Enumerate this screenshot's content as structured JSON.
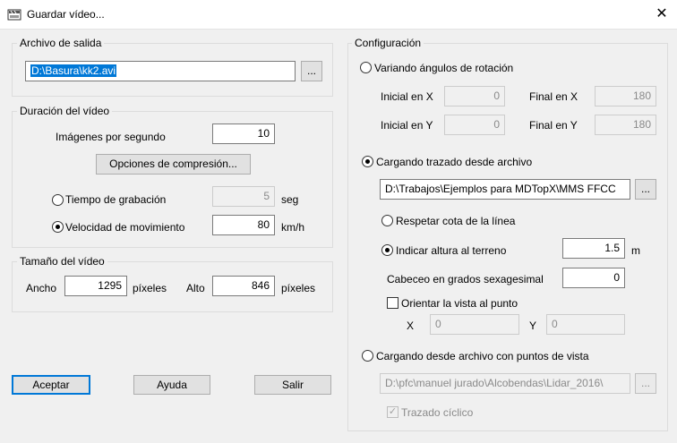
{
  "window": {
    "title": "Guardar vídeo...",
    "close_glyph": "✕"
  },
  "salida": {
    "legend": "Archivo de salida",
    "path": "D:\\Basura\\kk2.avi",
    "browse": "..."
  },
  "duracion": {
    "legend": "Duración del vídeo",
    "fps_label": "Imágenes por segundo",
    "fps_value": "10",
    "compresion_button": "Opciones de compresión...",
    "tiempo_label": "Tiempo de grabación",
    "tiempo_value": "5",
    "tiempo_unit": "seg",
    "velocidad_label": "Velocidad de movimiento",
    "velocidad_value": "80",
    "velocidad_unit": "km/h"
  },
  "tamano": {
    "legend": "Tamaño del vídeo",
    "ancho_label": "Ancho",
    "ancho_value": "1295",
    "ancho_unit": "píxeles",
    "alto_label": "Alto",
    "alto_value": "846",
    "alto_unit": "píxeles"
  },
  "buttons": {
    "aceptar": "Aceptar",
    "ayuda": "Ayuda",
    "salir": "Salir"
  },
  "config": {
    "legend": "Configuración",
    "variando_label": "Variando ángulos de rotación",
    "inicio_x_label": "Inicial en X",
    "inicio_x_value": "0",
    "final_x_label": "Final en X",
    "final_x_value": "180",
    "inicio_y_label": "Inicial en Y",
    "inicio_y_value": "0",
    "final_y_label": "Final en Y",
    "final_y_value": "180",
    "trazado_label": "Cargando trazado desde archivo",
    "trazado_path": "D:\\Trabajos\\Ejemplos para MDTopX\\MMS FFCC",
    "trazado_browse": "...",
    "respetar_label": "Respetar cota de la línea",
    "indicar_label": "Indicar altura al terreno",
    "indicar_value": "1.5",
    "indicar_unit": "m",
    "cabeceo_label": "Cabeceo en grados sexagesimal",
    "cabeceo_value": "0",
    "orientar_label": "Orientar la vista al punto",
    "x_label": "X",
    "x_value": "0",
    "y_label": "Y",
    "y_value": "0",
    "puntos_label": "Cargando desde archivo con puntos de vista",
    "puntos_path": "D:\\pfc\\manuel jurado\\Alcobendas\\Lidar_2016\\",
    "puntos_browse": "...",
    "ciclico_label": "Trazado cíclico"
  }
}
